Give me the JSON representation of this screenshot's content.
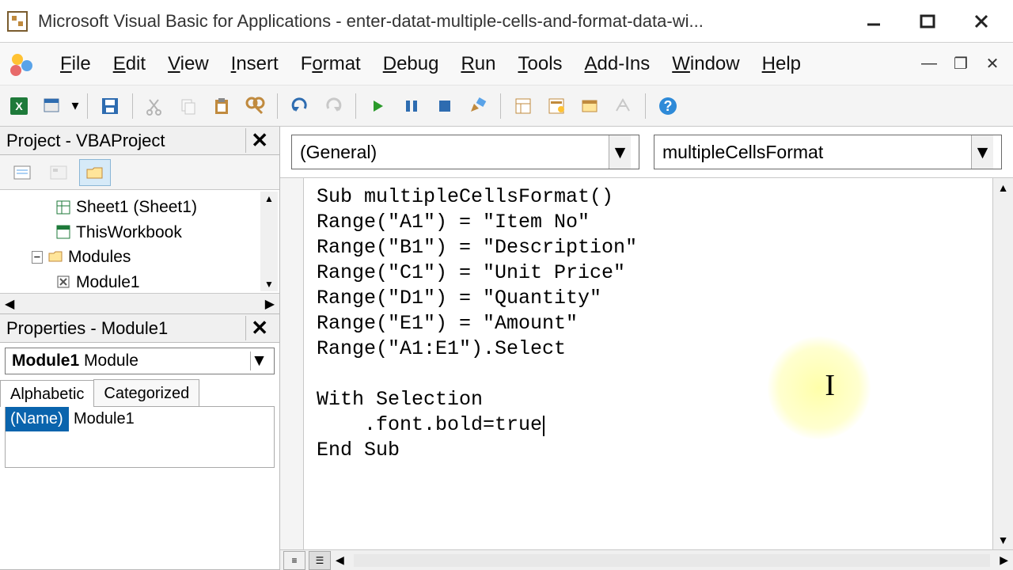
{
  "title": "Microsoft Visual Basic for Applications - enter-datat-multiple-cells-and-format-data-wi...",
  "menus": [
    "File",
    "Edit",
    "View",
    "Insert",
    "Format",
    "Debug",
    "Run",
    "Tools",
    "Add-Ins",
    "Window",
    "Help"
  ],
  "project": {
    "panel_title": "Project - VBAProject",
    "items": [
      {
        "label": "Sheet1 (Sheet1)",
        "icon": "sheet"
      },
      {
        "label": "ThisWorkbook",
        "icon": "workbook"
      },
      {
        "label": "Modules",
        "icon": "folder",
        "expandable": true
      },
      {
        "label": "Module1",
        "icon": "module",
        "indent": true
      }
    ]
  },
  "properties": {
    "panel_title": "Properties - Module1",
    "object_name": "Module1",
    "object_type": "Module",
    "tabs": [
      "Alphabetic",
      "Categorized"
    ],
    "rows": [
      {
        "name": "(Name)",
        "value": "Module1"
      }
    ]
  },
  "editor": {
    "left_combo": "(General)",
    "right_combo": "multipleCellsFormat",
    "code_lines": [
      "Sub multipleCellsFormat()",
      "Range(\"A1\") = \"Item No\"",
      "Range(\"B1\") = \"Description\"",
      "Range(\"C1\") = \"Unit Price\"",
      "Range(\"D1\") = \"Quantity\"",
      "Range(\"E1\") = \"Amount\"",
      "Range(\"A1:E1\").Select",
      "",
      "With Selection",
      "    .font.bold=true",
      "End Sub"
    ],
    "caret_line_index": 9
  }
}
